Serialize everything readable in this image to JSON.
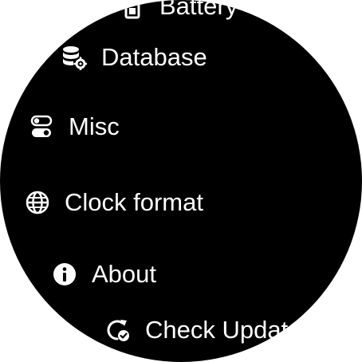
{
  "menu": {
    "items": [
      {
        "label": "Battery",
        "icon": "battery-icon"
      },
      {
        "label": "Database",
        "icon": "database-settings-icon"
      },
      {
        "label": "Misc",
        "icon": "toggle-icon"
      },
      {
        "label": "Clock format",
        "icon": "globe-icon"
      },
      {
        "label": "About",
        "icon": "info-icon"
      },
      {
        "label": "Check Updates",
        "icon": "refresh-check-icon"
      }
    ]
  },
  "colors": {
    "background": "#000000",
    "text": "#ffffff",
    "page": "#ffffff"
  }
}
